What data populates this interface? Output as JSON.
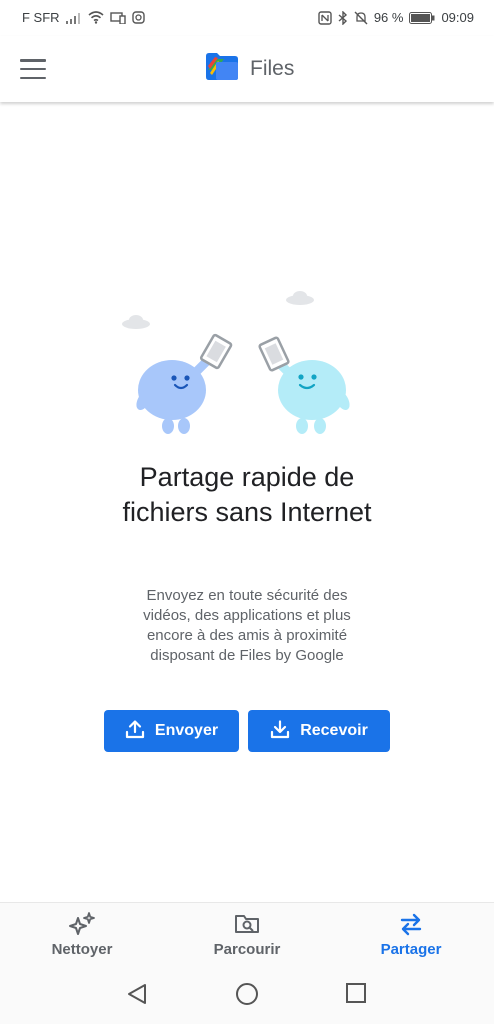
{
  "status_bar": {
    "carrier": "F SFR",
    "battery": "96 %",
    "time": "09:09"
  },
  "app_bar": {
    "title": "Files",
    "logo_icon": "files-logo-icon",
    "menu_icon": "menu-icon"
  },
  "share": {
    "headline": "Partage rapide de fichiers sans Internet",
    "description": "Envoyez en toute sécurité des vidéos, des applications et plus encore à des amis à proximité disposant de Files by Google",
    "send_label": "Envoyer",
    "receive_label": "Recevoir"
  },
  "bottom_nav": {
    "items": [
      {
        "label": "Nettoyer",
        "icon": "sparkle-icon",
        "active": false
      },
      {
        "label": "Parcourir",
        "icon": "folder-search-icon",
        "active": false
      },
      {
        "label": "Partager",
        "icon": "swap-arrows-icon",
        "active": true
      }
    ]
  },
  "colors": {
    "accent": "#1a73e8",
    "text_primary": "#202124",
    "text_secondary": "#5f6368"
  }
}
